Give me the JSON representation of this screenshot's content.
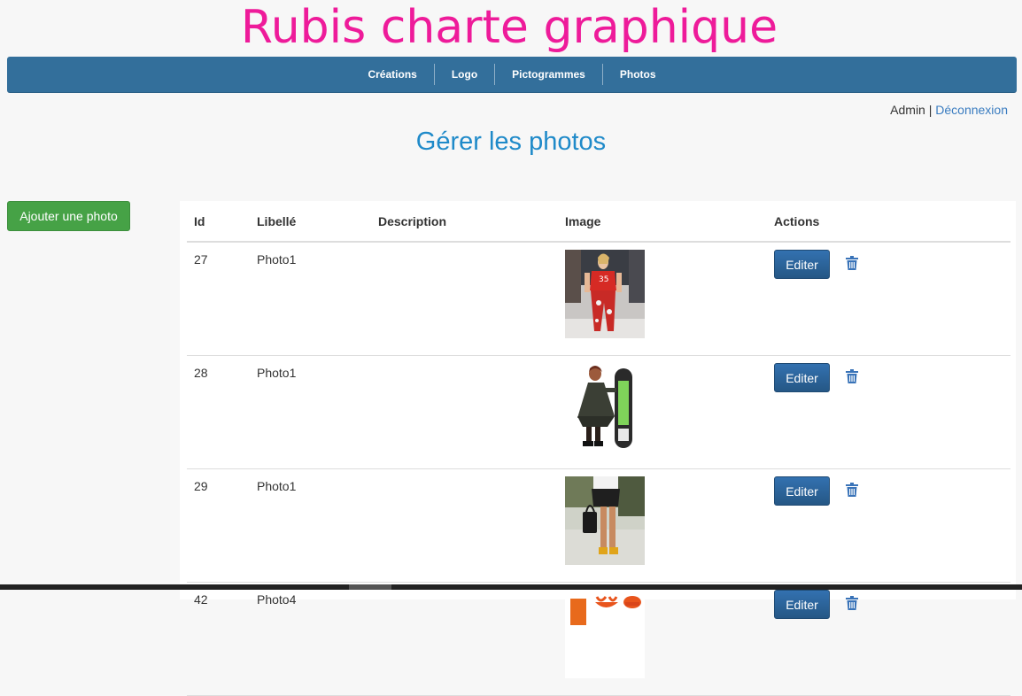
{
  "site": {
    "title": "Rubis charte graphique",
    "title_color": "#ee1b9a"
  },
  "nav": {
    "items": [
      {
        "label": "Créations"
      },
      {
        "label": "Logo"
      },
      {
        "label": "Pictogrammes"
      },
      {
        "label": "Photos"
      }
    ],
    "background": "#336f9b"
  },
  "user": {
    "name": "Admin",
    "separator": "|",
    "logout_label": "Déconnexion"
  },
  "page": {
    "heading": "Gérer les photos",
    "heading_color": "#1f8ac9"
  },
  "actions": {
    "add_label": "Ajouter une photo"
  },
  "table": {
    "headers": {
      "id": "Id",
      "label": "Libellé",
      "description": "Description",
      "image": "Image",
      "actions": "Actions"
    },
    "rows": [
      {
        "id": "27",
        "label": "Photo1",
        "description": "",
        "image": "runway-model-red-outfit",
        "edit_label": "Editer"
      },
      {
        "id": "28",
        "label": "Photo1",
        "description": "",
        "image": "woman-with-snowboard",
        "edit_label": "Editer"
      },
      {
        "id": "29",
        "label": "Photo1",
        "description": "",
        "image": "woman-with-handbag-street",
        "edit_label": "Editer"
      },
      {
        "id": "42",
        "label": "Photo4",
        "description": "",
        "image": "orange-clothing-items",
        "edit_label": "Editer"
      }
    ]
  },
  "icons": {
    "delete": "trash-icon"
  }
}
